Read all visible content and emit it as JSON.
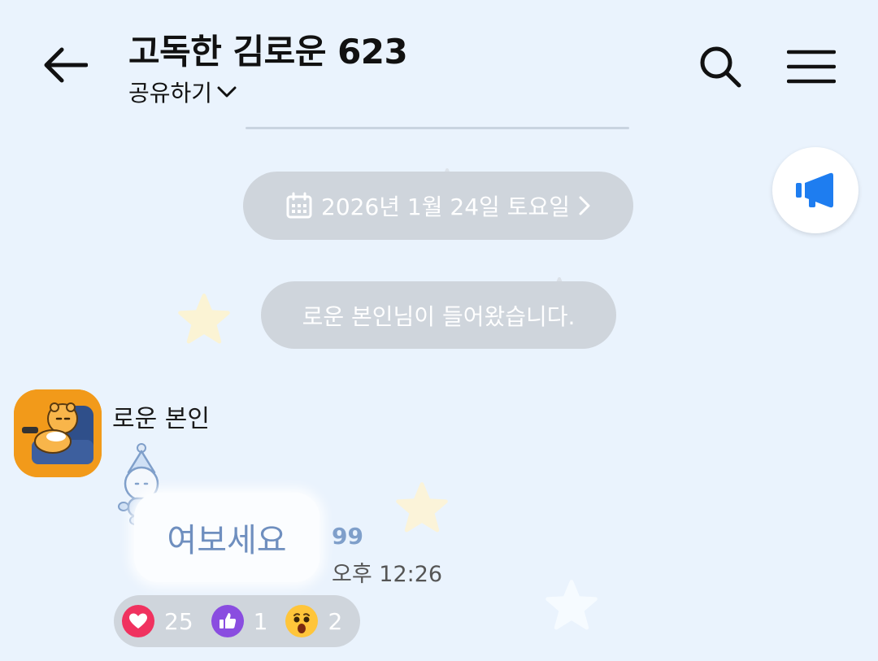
{
  "header": {
    "title": "고독한 김로운 623",
    "share_label": "공유하기"
  },
  "date_divider": {
    "label": "2026년 1월 24일 토요일"
  },
  "system_message": "로운 본인님이 들어왔습니다.",
  "message": {
    "sender": "로운 본인",
    "text": "여보세요",
    "unread_count": "99",
    "time": "오후 12:26"
  },
  "reactions": [
    {
      "icon": "heart-icon",
      "count": "25",
      "color": "#f0325f"
    },
    {
      "icon": "thumbs-up-icon",
      "count": "1",
      "color": "#8a4de0"
    },
    {
      "icon": "surprised-face-icon",
      "count": "2",
      "color": "#ffc53a"
    }
  ],
  "colors": {
    "background": "#eaf3fd",
    "pill": "#cfd5dc",
    "announce_accent": "#1e7df0",
    "bubble_text": "#6f8fbf"
  }
}
